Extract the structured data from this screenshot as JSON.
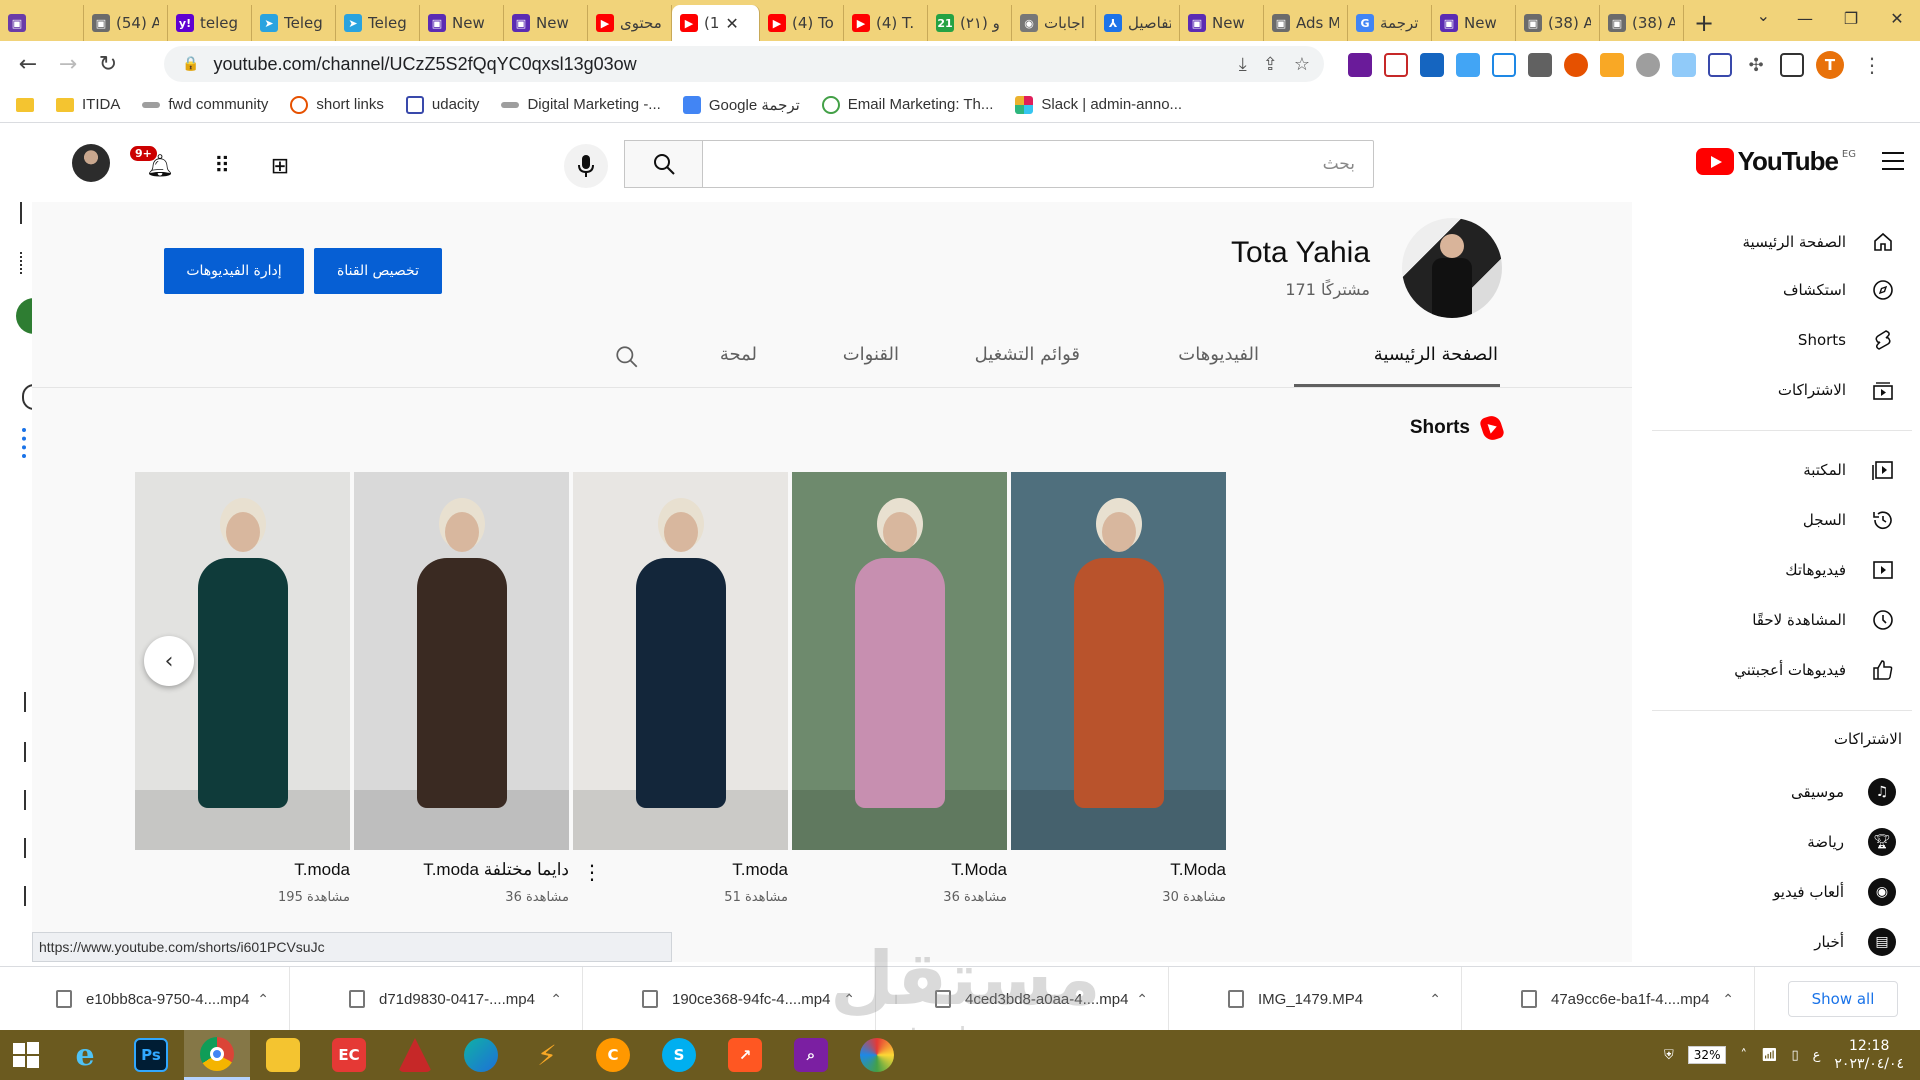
{
  "browser": {
    "tabs": [
      {
        "label": "",
        "color": "#6a3ba8",
        "glyph": "▣"
      },
      {
        "label": "(54) A",
        "color": "#6b6b6b",
        "glyph": "▣"
      },
      {
        "label": "teleg",
        "color": "#5f01d1",
        "glyph": "y!"
      },
      {
        "label": "Teleg",
        "color": "#2aa3df",
        "glyph": "➤"
      },
      {
        "label": "Teleg",
        "color": "#2aa3df",
        "glyph": "➤"
      },
      {
        "label": "New",
        "color": "#5b2bb3",
        "glyph": "▣"
      },
      {
        "label": "New",
        "color": "#5b2bb3",
        "glyph": "▣"
      },
      {
        "label": "محتوى",
        "color": "#ff0000",
        "glyph": "▶"
      },
      {
        "label": "(1",
        "color": "#ff0000",
        "glyph": "▶",
        "active": true
      },
      {
        "label": "(4) To",
        "color": "#ff0000",
        "glyph": "▶"
      },
      {
        "label": "(4) T.",
        "color": "#ff0000",
        "glyph": "▶"
      },
      {
        "label": "(٢١) و",
        "color": "#25a244",
        "glyph": "21"
      },
      {
        "label": "اجابات",
        "color": "#777777",
        "glyph": "◉"
      },
      {
        "label": "تفاصيل",
        "color": "#1d73e8",
        "glyph": "⅄"
      },
      {
        "label": "New",
        "color": "#5b2bb3",
        "glyph": "▣"
      },
      {
        "label": "Ads M",
        "color": "#6b6b6b",
        "glyph": "▣"
      },
      {
        "label": "ترجمة",
        "color": "#4285f4",
        "glyph": "G"
      },
      {
        "label": "New",
        "color": "#5b2bb3",
        "glyph": "▣"
      },
      {
        "label": "(38) A",
        "color": "#6b6b6b",
        "glyph": "▣"
      },
      {
        "label": "(38) A",
        "color": "#6b6b6b",
        "glyph": "▣"
      }
    ],
    "new_tab": "+",
    "url": "youtube.com/channel/UCzZ5S2fQqYC0qxsl13g03ow",
    "profile_initial": "T",
    "bookmarks": [
      "ITIDA",
      "fwd community",
      "short links",
      "udacity",
      "Digital Marketing -...",
      "Google ترجمة",
      "Email Marketing: Th...",
      "Slack | admin-anno..."
    ]
  },
  "youtube": {
    "logo_text": "YouTube",
    "region": "EG",
    "search_placeholder": "بحث",
    "notif_count": "9+",
    "channel": {
      "name": "Tota Yahia",
      "subscribers": "171 مشتركًا",
      "customize_btn": "تخصيص القناة",
      "manage_btn": "إدارة الفيديوهات"
    },
    "tabs": [
      "الصفحة الرئيسية",
      "الفيديوهات",
      "قوائم التشغيل",
      "القنوات",
      "لمحة"
    ],
    "shorts_label": "Shorts",
    "shorts": [
      {
        "title": "T.Moda",
        "views": "30 مشاهدة",
        "bg": "#4f6f7d",
        "outfit": "#b9532c"
      },
      {
        "title": "T.Moda",
        "views": "36 مشاهدة",
        "bg": "#6e8a6d",
        "outfit": "#c78fb0"
      },
      {
        "title": "T.moda",
        "views": "51 مشاهدة",
        "bg": "#e8e6e3",
        "outfit": "#13263a"
      },
      {
        "title": "T.moda دايما مختلفة",
        "views": "36 مشاهدة",
        "bg": "#d9d9d9",
        "outfit": "#3a2a22"
      },
      {
        "title": "T.moda",
        "views": "195 مشاهدة",
        "bg": "#e2e2e0",
        "outfit": "#0f3b3a"
      }
    ],
    "hover_url": "https://www.youtube.com/shorts/i601PCVsuJc"
  },
  "guide": {
    "main": [
      "الصفحة الرئيسية",
      "استكشاف",
      "Shorts",
      "الاشتراكات"
    ],
    "library": [
      "المكتبة",
      "السجل",
      "فيديوهاتك",
      "المشاهدة لاحقًا",
      "فيديوهات أعجبتني"
    ],
    "subscriptions_heading": "الاشتراكات",
    "subscriptions": [
      "موسيقى",
      "رياضة",
      "ألعاب فيديو",
      "أخبار"
    ]
  },
  "downloads": {
    "files": [
      "e10bb8ca-9750-4....mp4",
      "d71d9830-0417-....mp4",
      "190ce368-94fc-4....mp4",
      "4ced3bd8-a0aa-4....mp4",
      "IMG_1479.MP4",
      "47a9cc6e-ba1f-4....mp4"
    ],
    "show_all": "Show all"
  },
  "taskbar": {
    "battery": "32%",
    "lang": "ع",
    "time": "12:18",
    "date": "٢٠٢٣/٠٤/٠٤"
  },
  "watermark": {
    "text": "مستقل",
    "subtext": "mostaql.com"
  }
}
